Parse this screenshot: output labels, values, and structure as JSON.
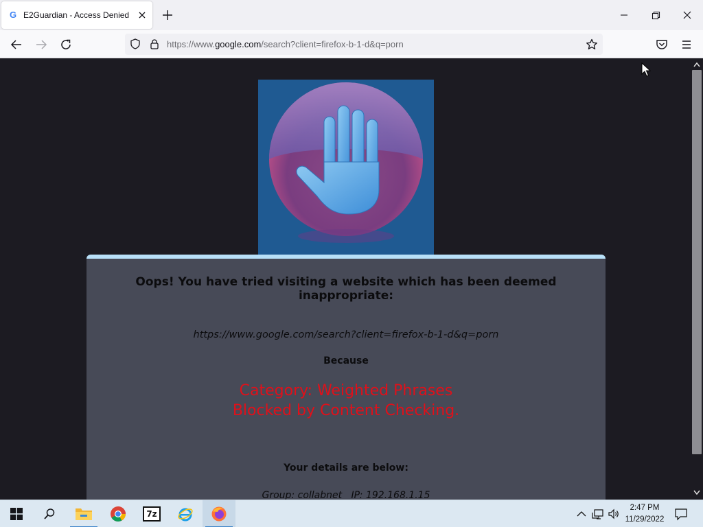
{
  "browser": {
    "tab": {
      "favicon_letter": "G",
      "title": "E2Guardian - Access Denied"
    },
    "url": {
      "scheme": "https://www.",
      "domain": "google.com",
      "path": "/search?client=firefox-b-1-d&q=porn"
    }
  },
  "page": {
    "heading": "Oops! You have tried visiting a website which has been deemed inappropriate:",
    "blocked_url": "https://www.google.com/search?client=firefox-b-1-d&q=porn",
    "because_label": "Because",
    "reason_line1": "Category: Weighted Phrases",
    "reason_line2": "Blocked by Content Checking.",
    "details_heading": "Your details are below:",
    "group_label": "Group:",
    "group_value": "collabnet",
    "ip_label": "IP:",
    "ip_value": "192.168.1.15"
  },
  "taskbar": {
    "apps": [
      "start-icon",
      "search-icon",
      "file-explorer-icon",
      "chrome-icon",
      "7zip-icon",
      "internet-explorer-icon",
      "firefox-icon"
    ],
    "sevenzip_label": "7z",
    "clock": {
      "time": "2:47 PM",
      "date": "11/29/2022"
    }
  },
  "colors": {
    "reason": "#e0101a",
    "card": "#474a57",
    "card_border": "#b8e0f8",
    "background": "#1c1b22"
  }
}
